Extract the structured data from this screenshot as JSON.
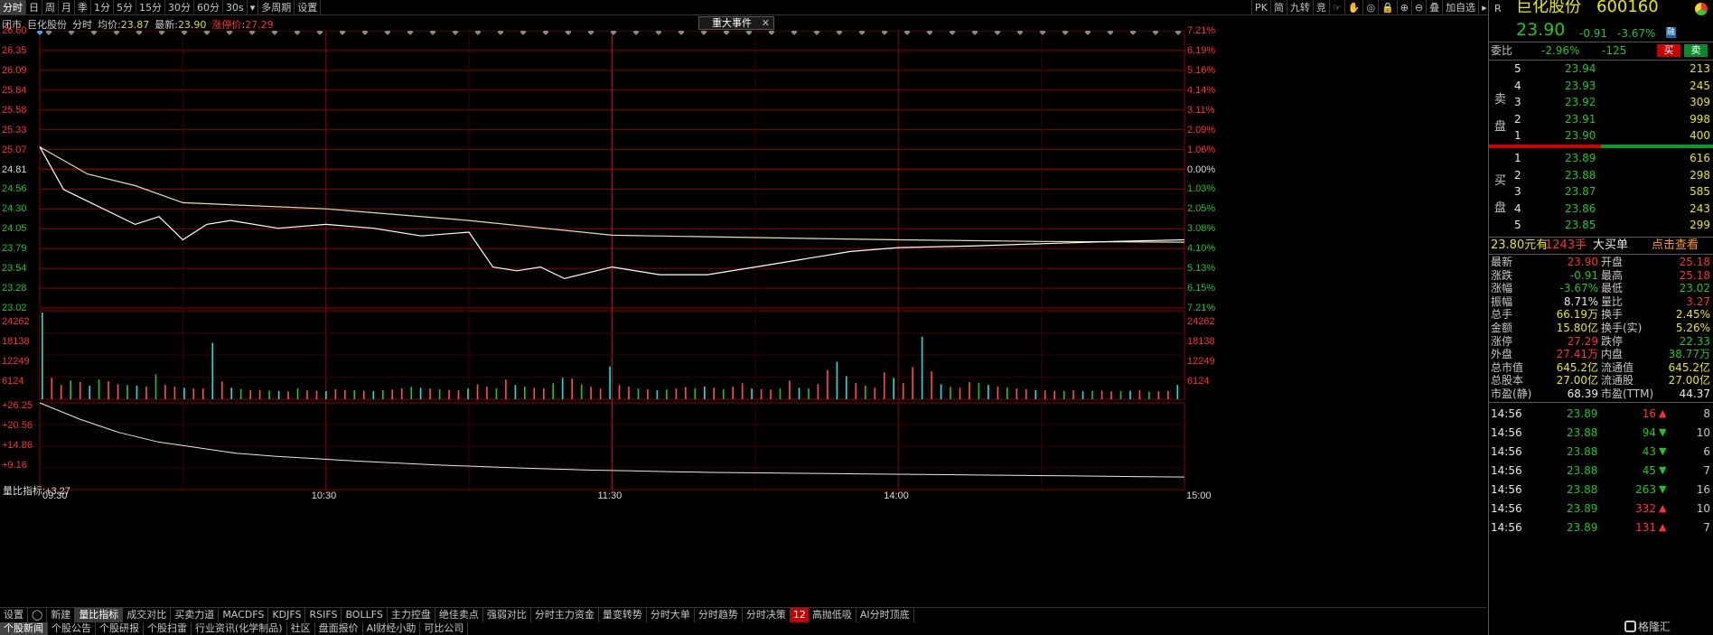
{
  "toolbar": {
    "left_items": [
      "分时",
      "日",
      "周",
      "月",
      "季",
      "1分",
      "5分",
      "15分",
      "30分",
      "60分",
      "30s",
      "▾",
      "多周期",
      "设置"
    ],
    "active_index": 0,
    "right_items": [
      "PK",
      "简",
      "九转",
      "竞",
      "☞",
      "✋",
      "◎",
      "🔒",
      "⊕",
      "⊖",
      "叠",
      "加自选",
      "▸|",
      "▾"
    ]
  },
  "infobar": {
    "status": "闭市",
    "stock": "巨化股份",
    "mode": "分时",
    "avg_label": "均价:",
    "avg_value": "23.87",
    "last_label": "最新:",
    "last_value": "23.90",
    "limit_label": "涨停价",
    "limit_value": "27.29"
  },
  "event_tag": {
    "label": "重大事件",
    "close": "✕"
  },
  "price_axis": {
    "left": [
      "26.60",
      "26.35",
      "26.09",
      "25.84",
      "25.58",
      "25.33",
      "25.07",
      "24.81",
      "24.56",
      "24.30",
      "24.05",
      "23.79",
      "23.54",
      "23.28",
      "23.02"
    ],
    "right": [
      "7.21%",
      "6.19%",
      "5.16%",
      "4.14%",
      "3.11%",
      "2.09%",
      "1.06%",
      "0.00%",
      "1.03%",
      "2.05%",
      "3.08%",
      "4.10%",
      "5.13%",
      "6.15%",
      "7.21%"
    ]
  },
  "volume_axis": {
    "labels": [
      "24262",
      "18138",
      "12249",
      "6124"
    ]
  },
  "indicator": {
    "title": "量比指标:",
    "value": "+3.27",
    "labels": [
      "+26.25",
      "+20.56",
      "+14.86",
      "+9.16"
    ]
  },
  "time_axis": [
    "09:30",
    "10:30",
    "11:30",
    "14:00",
    "15:00"
  ],
  "bottom_tabs": [
    "设置",
    "◯",
    "新建",
    "量比指标",
    "成交对比",
    "买卖力道",
    "MACDFS",
    "KDJFS",
    "RSIFS",
    "BOLLFS",
    "主力控盘",
    "绝佳卖点",
    "强弱对比",
    "分时主力资金",
    "量变转势",
    "分时大单",
    "分时趋势",
    "分时决策",
    "12",
    "高抛低吸",
    "AI分时顶底"
  ],
  "bottom_tabs_active": 3,
  "bottom_tabs2": [
    "个股新闻",
    "个股公告",
    "个股研报",
    "个股扫雷",
    "行业资讯(化学制品)",
    "社区",
    "盘面报价",
    "AI财经小助",
    "可比公司"
  ],
  "chart_data": {
    "type": "line",
    "xlabel": "",
    "ylabel": "",
    "ylim": [
      23.02,
      26.6
    ],
    "prev_close": 24.81,
    "series": [
      {
        "name": "分时",
        "x": [
          "09:30",
          "09:35",
          "09:40",
          "09:45",
          "09:50",
          "09:55",
          "10:00",
          "10:05",
          "10:10",
          "10:20",
          "10:30",
          "10:40",
          "10:50",
          "11:00",
          "11:05",
          "11:10",
          "11:15",
          "11:20",
          "11:30",
          "13:10",
          "13:20",
          "13:30",
          "13:40",
          "13:50",
          "14:00",
          "14:15",
          "14:30",
          "14:45",
          "15:00"
        ],
        "values": [
          25.1,
          24.55,
          24.4,
          24.25,
          24.1,
          24.2,
          23.9,
          24.1,
          24.15,
          24.05,
          24.1,
          24.05,
          23.95,
          24.0,
          23.55,
          23.5,
          23.55,
          23.4,
          23.55,
          23.45,
          23.45,
          23.55,
          23.65,
          23.75,
          23.8,
          23.82,
          23.85,
          23.88,
          23.9
        ]
      },
      {
        "name": "均价",
        "x": [
          "09:30",
          "09:40",
          "09:50",
          "10:00",
          "10:30",
          "11:00",
          "11:30",
          "13:30",
          "14:00",
          "14:30",
          "15:00"
        ],
        "values": [
          25.1,
          24.75,
          24.6,
          24.38,
          24.3,
          24.15,
          23.96,
          23.93,
          23.9,
          23.88,
          23.87
        ]
      }
    ],
    "volume": {
      "max": 24262,
      "bars": [
        24262,
        6000,
        4000,
        5200,
        4800,
        3800,
        5500,
        5000,
        4200,
        4000,
        3800,
        3600,
        7000,
        4000,
        3500,
        3200,
        3000,
        3000,
        15800,
        5000,
        3200,
        2800,
        2500,
        2600,
        2400,
        2300,
        2200,
        3000,
        2500,
        2400,
        2300,
        2800,
        2600,
        2500,
        2400,
        2300,
        2500,
        2700,
        3000,
        3500,
        3200,
        3000,
        2800,
        2600,
        2500,
        3000,
        4200,
        3500,
        3000,
        5500,
        4000,
        3500,
        3200,
        3000,
        4500,
        6000,
        5800,
        4200,
        3500,
        3000,
        9200,
        4000,
        3500,
        3000,
        2800,
        2500,
        2700,
        3000,
        3400,
        3000,
        3600,
        3200,
        2800,
        3500,
        4500,
        3000,
        2800,
        2700,
        3000,
        5200,
        3200,
        3000,
        4200,
        8200,
        10500,
        6500,
        4500,
        3800,
        3200,
        7500,
        6000,
        4500,
        9000,
        17500,
        7800,
        4200,
        3500,
        3200,
        4800,
        4500,
        4000,
        3600,
        3200,
        3000,
        2800,
        2600,
        2500,
        2400,
        2300,
        2500,
        2200,
        2300,
        2400,
        2200,
        2300,
        2400,
        2500,
        2100,
        2200,
        2300,
        4000
      ]
    },
    "volume_ratio": {
      "values": [
        26.25,
        22.0,
        18.5,
        16.0,
        14.5,
        13.0,
        12.2,
        11.6,
        11.0,
        10.5,
        10.0,
        9.6,
        9.2,
        8.9,
        8.6,
        8.4,
        8.2,
        8.0,
        7.9,
        7.8,
        7.7,
        7.6,
        7.5,
        7.4,
        7.3,
        7.2,
        7.1,
        7.0,
        6.9,
        6.8
      ]
    }
  },
  "rpanel": {
    "flag": "R",
    "name": "巨化股份",
    "code": "600160",
    "price": "23.90",
    "change": "-0.91",
    "change_pct": "-3.67%",
    "market_tag": "融",
    "webi_label": "委比",
    "webi_value": "-2.96%",
    "wecha_value": "-125",
    "buy_btn": "买",
    "sell_btn": "卖",
    "sell_label": [
      "卖",
      "盘"
    ],
    "buy_label": [
      "买",
      "盘"
    ],
    "asks": [
      {
        "lvl": "5",
        "price": "23.94",
        "vol": "213"
      },
      {
        "lvl": "4",
        "price": "23.93",
        "vol": "245"
      },
      {
        "lvl": "3",
        "price": "23.92",
        "vol": "309"
      },
      {
        "lvl": "2",
        "price": "23.91",
        "vol": "998"
      },
      {
        "lvl": "1",
        "price": "23.90",
        "vol": "400"
      }
    ],
    "bids": [
      {
        "lvl": "1",
        "price": "23.89",
        "vol": "616"
      },
      {
        "lvl": "2",
        "price": "23.88",
        "vol": "298"
      },
      {
        "lvl": "3",
        "price": "23.87",
        "vol": "585"
      },
      {
        "lvl": "4",
        "price": "23.86",
        "vol": "243"
      },
      {
        "lvl": "5",
        "price": "23.85",
        "vol": "299"
      }
    ],
    "bigorder": {
      "price": "23.80元有",
      "qty": "1243手",
      "label": "大买单",
      "link": "点击查看"
    },
    "stats": [
      {
        "l1": "最新",
        "v1": "23.90",
        "c1": "c-red",
        "l2": "开盘",
        "v2": "25.18",
        "c2": "c-red"
      },
      {
        "l1": "涨跌",
        "v1": "-0.91",
        "c1": "c-green",
        "l2": "最高",
        "v2": "25.18",
        "c2": "c-red"
      },
      {
        "l1": "涨幅",
        "v1": "-3.67%",
        "c1": "c-green",
        "l2": "最低",
        "v2": "23.02",
        "c2": "c-green"
      },
      {
        "l1": "振幅",
        "v1": "8.71%",
        "c1": "c-white",
        "l2": "量比",
        "v2": "3.27",
        "c2": "c-red"
      },
      {
        "l1": "总手",
        "v1": "66.19万",
        "c1": "c-yellow",
        "l2": "换手",
        "v2": "2.45%",
        "c2": "c-yellow"
      },
      {
        "l1": "金额",
        "v1": "15.80亿",
        "c1": "c-yellow",
        "l2": "换手(实)",
        "v2": "5.26%",
        "c2": "c-yellow"
      },
      {
        "l1": "涨停",
        "v1": "27.29",
        "c1": "c-red",
        "l2": "跌停",
        "v2": "22.33",
        "c2": "c-green"
      },
      {
        "l1": "外盘",
        "v1": "27.41万",
        "c1": "c-red",
        "l2": "内盘",
        "v2": "38.77万",
        "c2": "c-green"
      },
      {
        "l1": "总市值",
        "v1": "645.2亿",
        "c1": "c-yellow",
        "l2": "流通值",
        "v2": "645.2亿",
        "c2": "c-yellow"
      },
      {
        "l1": "总股本",
        "v1": "27.00亿",
        "c1": "c-yellow",
        "l2": "流通股",
        "v2": "27.00亿",
        "c2": "c-yellow"
      },
      {
        "l1": "市盈(静)",
        "v1": "68.39",
        "c1": "c-white",
        "l2": "市盈(TTM)",
        "v2": "44.37",
        "c2": "c-white"
      }
    ],
    "ticks": [
      {
        "time": "14:56",
        "price": "23.89",
        "vol": "16",
        "dir": "up",
        "n": "8"
      },
      {
        "time": "14:56",
        "price": "23.88",
        "vol": "94",
        "dir": "down",
        "n": "10"
      },
      {
        "time": "14:56",
        "price": "23.88",
        "vol": "43",
        "dir": "down",
        "n": "6"
      },
      {
        "time": "14:56",
        "price": "23.88",
        "vol": "45",
        "dir": "down",
        "n": "7"
      },
      {
        "time": "14:56",
        "price": "23.88",
        "vol": "263",
        "dir": "down",
        "n": "16"
      },
      {
        "time": "14:56",
        "price": "23.89",
        "vol": "332",
        "dir": "up",
        "n": "10"
      },
      {
        "time": "14:56",
        "price": "23.89",
        "vol": "131",
        "dir": "up",
        "n": "7"
      }
    ],
    "watermark": "格隆汇"
  },
  "colors": {
    "red": "#ff3030",
    "green": "#1ec81e",
    "yellow": "#e8e800",
    "cyan": "#1ee0e0",
    "grid": "#8b0000"
  }
}
